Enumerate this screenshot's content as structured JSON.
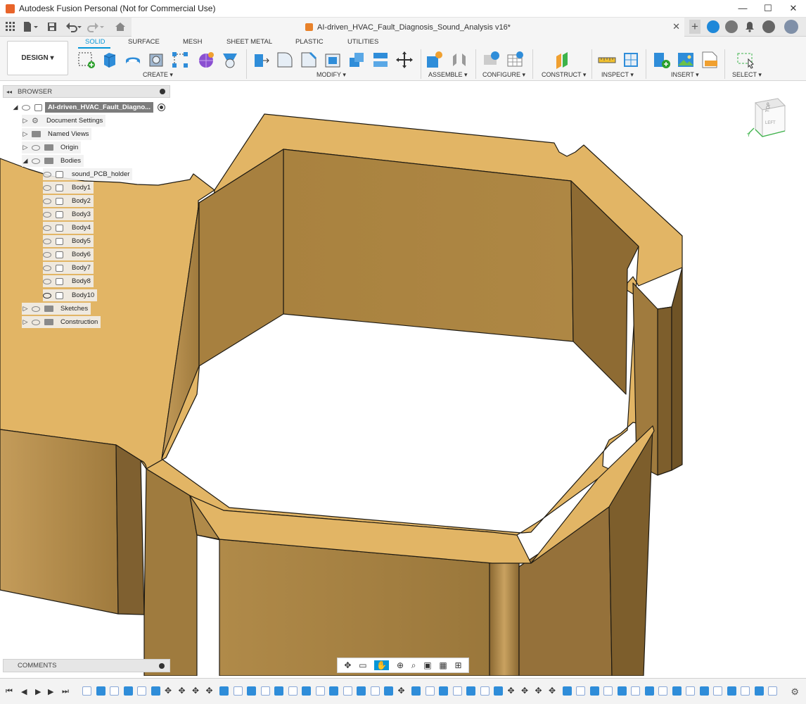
{
  "window": {
    "title": "Autodesk Fusion Personal (Not for Commercial Use)",
    "controls": [
      "—",
      "☐",
      "✕"
    ]
  },
  "tabbar": {
    "document_title": "AI-driven_HVAC_Fault_Diagnosis_Sound_Analysis v16*",
    "close_glyph": "✕",
    "new_tab_glyph": "+"
  },
  "ribbon": {
    "workspace_button": "DESIGN ▾",
    "tabs": [
      {
        "label": "SOLID",
        "active": true
      },
      {
        "label": "SURFACE",
        "active": false
      },
      {
        "label": "MESH",
        "active": false
      },
      {
        "label": "SHEET METAL",
        "active": false
      },
      {
        "label": "PLASTIC",
        "active": false
      },
      {
        "label": "UTILITIES",
        "active": false
      }
    ],
    "groups": {
      "create": "CREATE ▾",
      "modify": "MODIFY ▾",
      "assemble": "ASSEMBLE ▾",
      "configure": "CONFIGURE ▾",
      "construct": "CONSTRUCT ▾",
      "inspect": "INSPECT ▾",
      "insert": "INSERT ▾",
      "select": "SELECT ▾"
    },
    "accent": "#0696d7"
  },
  "browser": {
    "header": "BROWSER",
    "root": "AI-driven_HVAC_Fault_Diagno...",
    "nodes": [
      "Document Settings",
      "Named Views",
      "Origin",
      "Bodies",
      "sound_PCB_holder",
      "Body1",
      "Body2",
      "Body3",
      "Body4",
      "Body5",
      "Body6",
      "Body7",
      "Body8",
      "Body10",
      "Sketches",
      "Construction"
    ]
  },
  "comments": {
    "label": "COMMENTS"
  },
  "viewcube": {
    "top": "TOP",
    "left": "LEFT",
    "y_axis": "Y"
  },
  "colors": {
    "body_top": "#e2b565",
    "wall_light": "#c39a5a",
    "wall_dark": "#8d6a33",
    "edge": "#1e1a12"
  }
}
